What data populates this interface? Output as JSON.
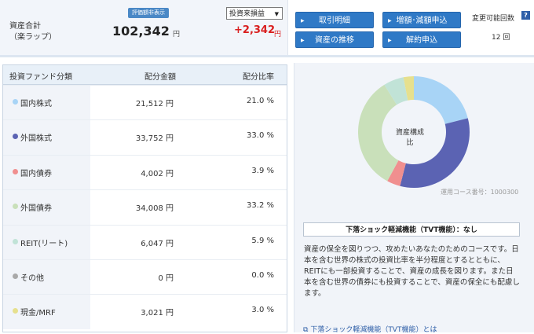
{
  "summary": {
    "total_label_line1": "資産合計",
    "total_label_line2": "（楽ラップ）",
    "hide_valuation_button": "評価額非表示",
    "total_value": "102,342",
    "yen": "円",
    "pl_select": "投資来損益",
    "pl_value": "+2,342",
    "pl_unit": "円"
  },
  "actions": {
    "transactions": "取引明細",
    "deposit": "増額･減額申込",
    "history": "資産の推移",
    "cancel": "解約申込",
    "changes_label": "変更可能回数",
    "changes_count": "12 回",
    "help_icon": "?"
  },
  "table": {
    "headers": {
      "category": "投資ファンド分類",
      "amount": "配分金額",
      "ratio": "配分比率"
    },
    "rows": [
      {
        "name": "国内株式",
        "amount": "21,512 円",
        "ratio": "21.0 %",
        "color": "#a8d4f6"
      },
      {
        "name": "外国株式",
        "amount": "33,752 円",
        "ratio": "33.0 %",
        "color": "#5b63b3"
      },
      {
        "name": "国内債券",
        "amount": "4,002 円",
        "ratio": "3.9 %",
        "color": "#f08f8f"
      },
      {
        "name": "外国債券",
        "amount": "34,008 円",
        "ratio": "33.2 %",
        "color": "#c9e0ba"
      },
      {
        "name": "REIT(リート)",
        "amount": "6,047 円",
        "ratio": "5.9 %",
        "color": "#c1e3d7"
      },
      {
        "name": "その他",
        "amount": "0 円",
        "ratio": "0.0 %",
        "color": "#a9a9a9"
      },
      {
        "name": "現金/MRF",
        "amount": "3,021 円",
        "ratio": "3.0 %",
        "color": "#e6e08e"
      }
    ]
  },
  "chart_data": {
    "type": "pie",
    "center_label": "資産構成比",
    "values": [
      21.0,
      33.0,
      3.9,
      33.2,
      5.9,
      0.0,
      3.0
    ],
    "colors": [
      "#a8d4f6",
      "#5b63b3",
      "#f08f8f",
      "#c9e0ba",
      "#c1e3d7",
      "#a9a9a9",
      "#e6e08e"
    ]
  },
  "info": {
    "course_id": "運用コース番号：1000300",
    "tvt_title": "下落ショック軽減機能（TVT機能）：なし",
    "description": "資産の保全を図りつつ、攻めたいあなたのためのコースです。日本を含む世界の株式の投資比率を半分程度とするとともに、REITにも一部投資することで、資産の成長を図ります。また日本を含む世界の債券にも投資することで、資産の保全にも配慮します。",
    "tvt_link": "下落ショック軽減機能（TVT機能）とは"
  }
}
